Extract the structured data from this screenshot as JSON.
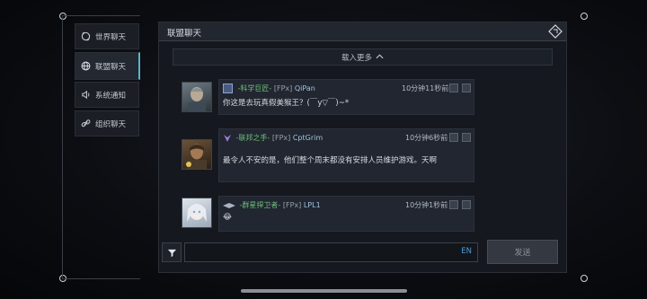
{
  "sidebar": {
    "items": [
      {
        "label": "世界聊天",
        "icon": "globe-cycle-icon",
        "active": false
      },
      {
        "label": "联盟聊天",
        "icon": "globe-icon",
        "active": true
      },
      {
        "label": "系统通知",
        "icon": "speaker-icon",
        "active": false
      },
      {
        "label": "组织聊天",
        "icon": "link-icon",
        "active": false
      }
    ]
  },
  "panel": {
    "title": "联盟聊天",
    "load_more": "载入更多"
  },
  "messages": [
    {
      "rank": "-科学巨匠-",
      "tag": "[FPx]",
      "name": "QiPan",
      "time": "10分钟11秒前",
      "text": "你这是去玩真假美猴王？(￣y▽￣)~*"
    },
    {
      "rank": "-联邦之手-",
      "tag": "[FPx]",
      "name": "CptGrim",
      "time": "10分钟6秒前",
      "text": "最令人不安的是，他们整个周末都没有安排人员维护游戏。天啊"
    },
    {
      "rank": "-群星捍卫者-",
      "tag": "[FPx]",
      "name": "LPL1",
      "time": "10分钟1秒前",
      "text": "😂"
    }
  ],
  "input": {
    "lang": "EN",
    "value": ""
  },
  "send_label": "发送",
  "colors": {
    "accent": "#5fb3c9",
    "rank_green": "#6fc07a"
  }
}
